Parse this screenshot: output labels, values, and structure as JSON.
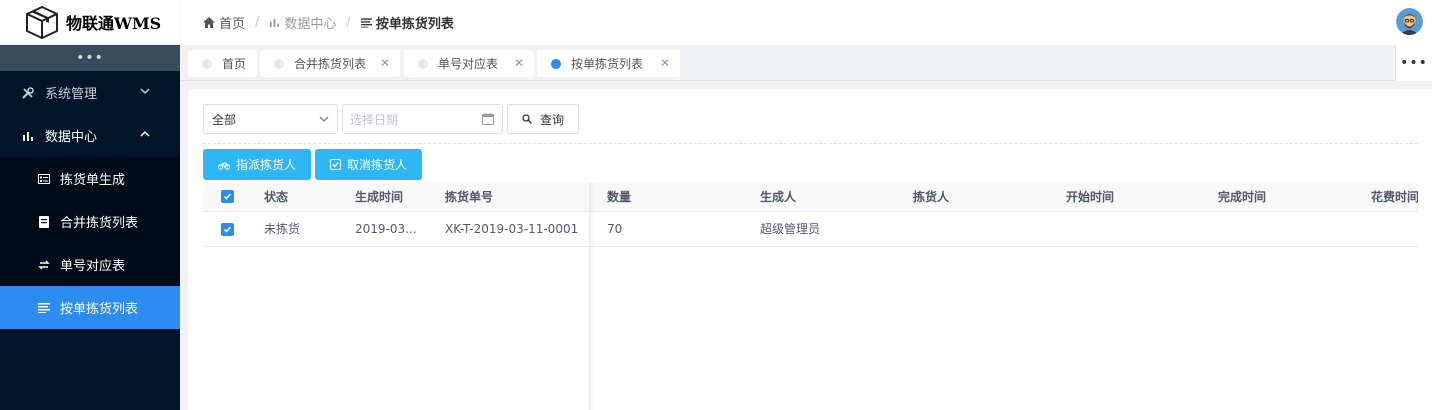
{
  "app": {
    "title": "物联通WMS"
  },
  "sidebar": {
    "collapse_label": "•••",
    "groups": [
      {
        "label": "系统管理",
        "icon": "tools-icon",
        "expanded": false
      },
      {
        "label": "数据中心",
        "icon": "bar-chart-icon",
        "expanded": true
      }
    ],
    "items": [
      {
        "label": "拣货单生成",
        "icon": "list-card-icon"
      },
      {
        "label": "合并拣货列表",
        "icon": "document-icon"
      },
      {
        "label": "单号对应表",
        "icon": "swap-icon"
      },
      {
        "label": "按单拣货列表",
        "icon": "list-icon",
        "active": true
      }
    ]
  },
  "breadcrumb": {
    "items": [
      {
        "label": "首页",
        "icon": "home-icon"
      },
      {
        "label": "数据中心",
        "icon": "bar-chart-icon"
      },
      {
        "label": "按单拣货列表",
        "icon": "list-icon"
      }
    ],
    "separator": "/"
  },
  "tabs": [
    {
      "label": "首页",
      "closable": false
    },
    {
      "label": "合并拣货列表",
      "closable": true
    },
    {
      "label": "单号对应表",
      "closable": true
    },
    {
      "label": "按单拣货列表",
      "closable": true,
      "active": true
    }
  ],
  "tabs_more": "•••",
  "filters": {
    "status_select": "全部",
    "date_placeholder": "选择日期",
    "query_label": "查询"
  },
  "actions": {
    "assign_label": "指派拣货人",
    "cancel_label": "取消拣货人"
  },
  "table": {
    "columns": [
      "状态",
      "生成时间",
      "拣货单号",
      "数量",
      "生成人",
      "拣货人",
      "开始时间",
      "完成时间",
      "花费时间"
    ],
    "rows": [
      {
        "checked": true,
        "status": "未拣货",
        "created": "2019-03...",
        "order_no": "XK-T-2019-03-11-0001",
        "quantity": "70",
        "creator": "超级管理员",
        "picker": "",
        "start": "",
        "finish": "",
        "duration": ""
      }
    ]
  },
  "colors": {
    "sidebar_bg": "#001529",
    "active": "#2d8cf0",
    "button_blue": "#2db7f5"
  }
}
